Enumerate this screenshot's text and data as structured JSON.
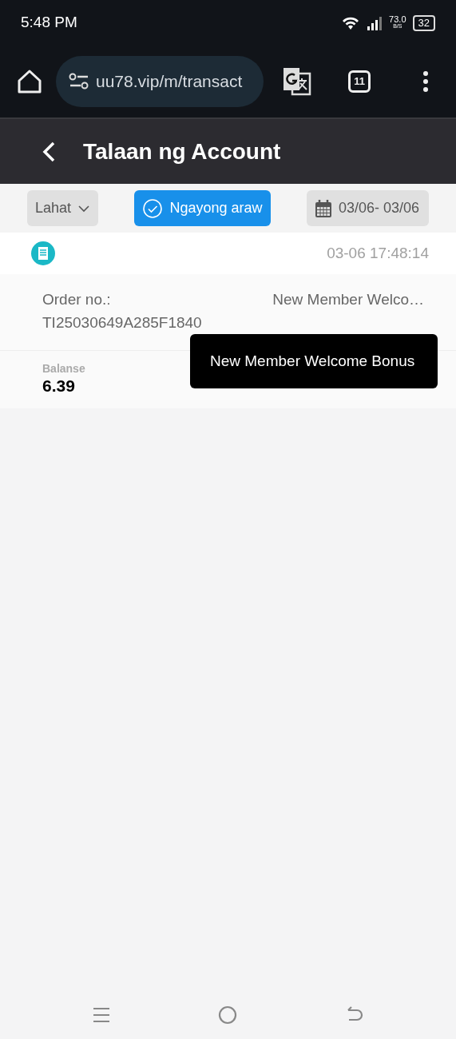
{
  "status_bar": {
    "time": "5:48 PM",
    "speed": "73.0",
    "speed_unit": "B/S",
    "battery": "32"
  },
  "browser": {
    "url": "uu78.vip/m/transact",
    "tab_count": "11"
  },
  "header": {
    "title": "Talaan ng Account"
  },
  "filters": [
    {
      "kind": "dropdown",
      "label": "Lahat",
      "selected": false
    },
    {
      "kind": "quick",
      "label": "Ngayong araw",
      "selected": true
    },
    {
      "kind": "date",
      "label": "03/06- 03/06",
      "selected": false
    }
  ],
  "records": [
    {
      "time": "03-06 17:48:14",
      "order_label": "Order no.:",
      "order_no": "TI25030649A285F1840",
      "type": "New Member Welco…",
      "balance_label": "Balanse",
      "balance": "6.39"
    }
  ],
  "tooltip": {
    "text": "New Member Welcome Bonus"
  }
}
